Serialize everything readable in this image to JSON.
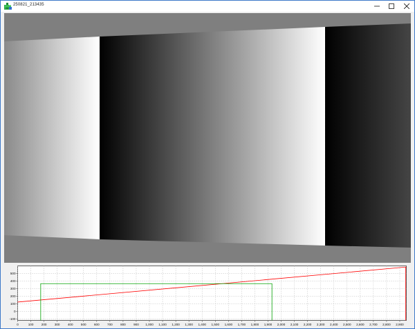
{
  "window": {
    "title": "250821_213435",
    "minimize_glyph": "—",
    "maximize_glyph": "☐",
    "close_glyph": "✕",
    "app_icon": "green-plus-app-icon"
  },
  "image_view": {
    "content": "grayscale-gradient-bands"
  },
  "chart_data": {
    "type": "line",
    "xlim": [
      0,
      2950
    ],
    "ylim": [
      -120,
      600
    ],
    "xticks": [
      0,
      100,
      200,
      300,
      400,
      500,
      600,
      700,
      800,
      900,
      1000,
      1100,
      1200,
      1300,
      1400,
      1500,
      1600,
      1700,
      1800,
      1900,
      2000,
      2100,
      2200,
      2300,
      2400,
      2500,
      2600,
      2700,
      2800,
      2900
    ],
    "xtick_labels": [
      "0",
      "100",
      "200",
      "300",
      "400",
      "500",
      "600",
      "700",
      "800",
      "900",
      "1,000",
      "1,100",
      "1,200",
      "1,300",
      "1,400",
      "1,500",
      "1,600",
      "1,700",
      "1,800",
      "1,900",
      "2,000",
      "2,100",
      "2,200",
      "2,300",
      "2,400",
      "2,500",
      "2,600",
      "2,700",
      "2,800",
      "2,900"
    ],
    "yticks": [
      -100,
      0,
      100,
      200,
      300,
      400,
      500
    ],
    "ytick_labels": [
      "-100",
      "0",
      "100",
      "200",
      "300",
      "400",
      "500"
    ],
    "grid": true,
    "series": [
      {
        "color": "#ff0000",
        "x": [
          0,
          2950
        ],
        "y": [
          122,
          585
        ]
      },
      {
        "color": "#00a000",
        "x": [
          175,
          175,
          1930,
          1930
        ],
        "y": [
          -120,
          365,
          365,
          -120
        ]
      },
      {
        "color": "#ff0000",
        "x": [
          2945,
          2945
        ],
        "y": [
          -120,
          585
        ]
      }
    ]
  }
}
